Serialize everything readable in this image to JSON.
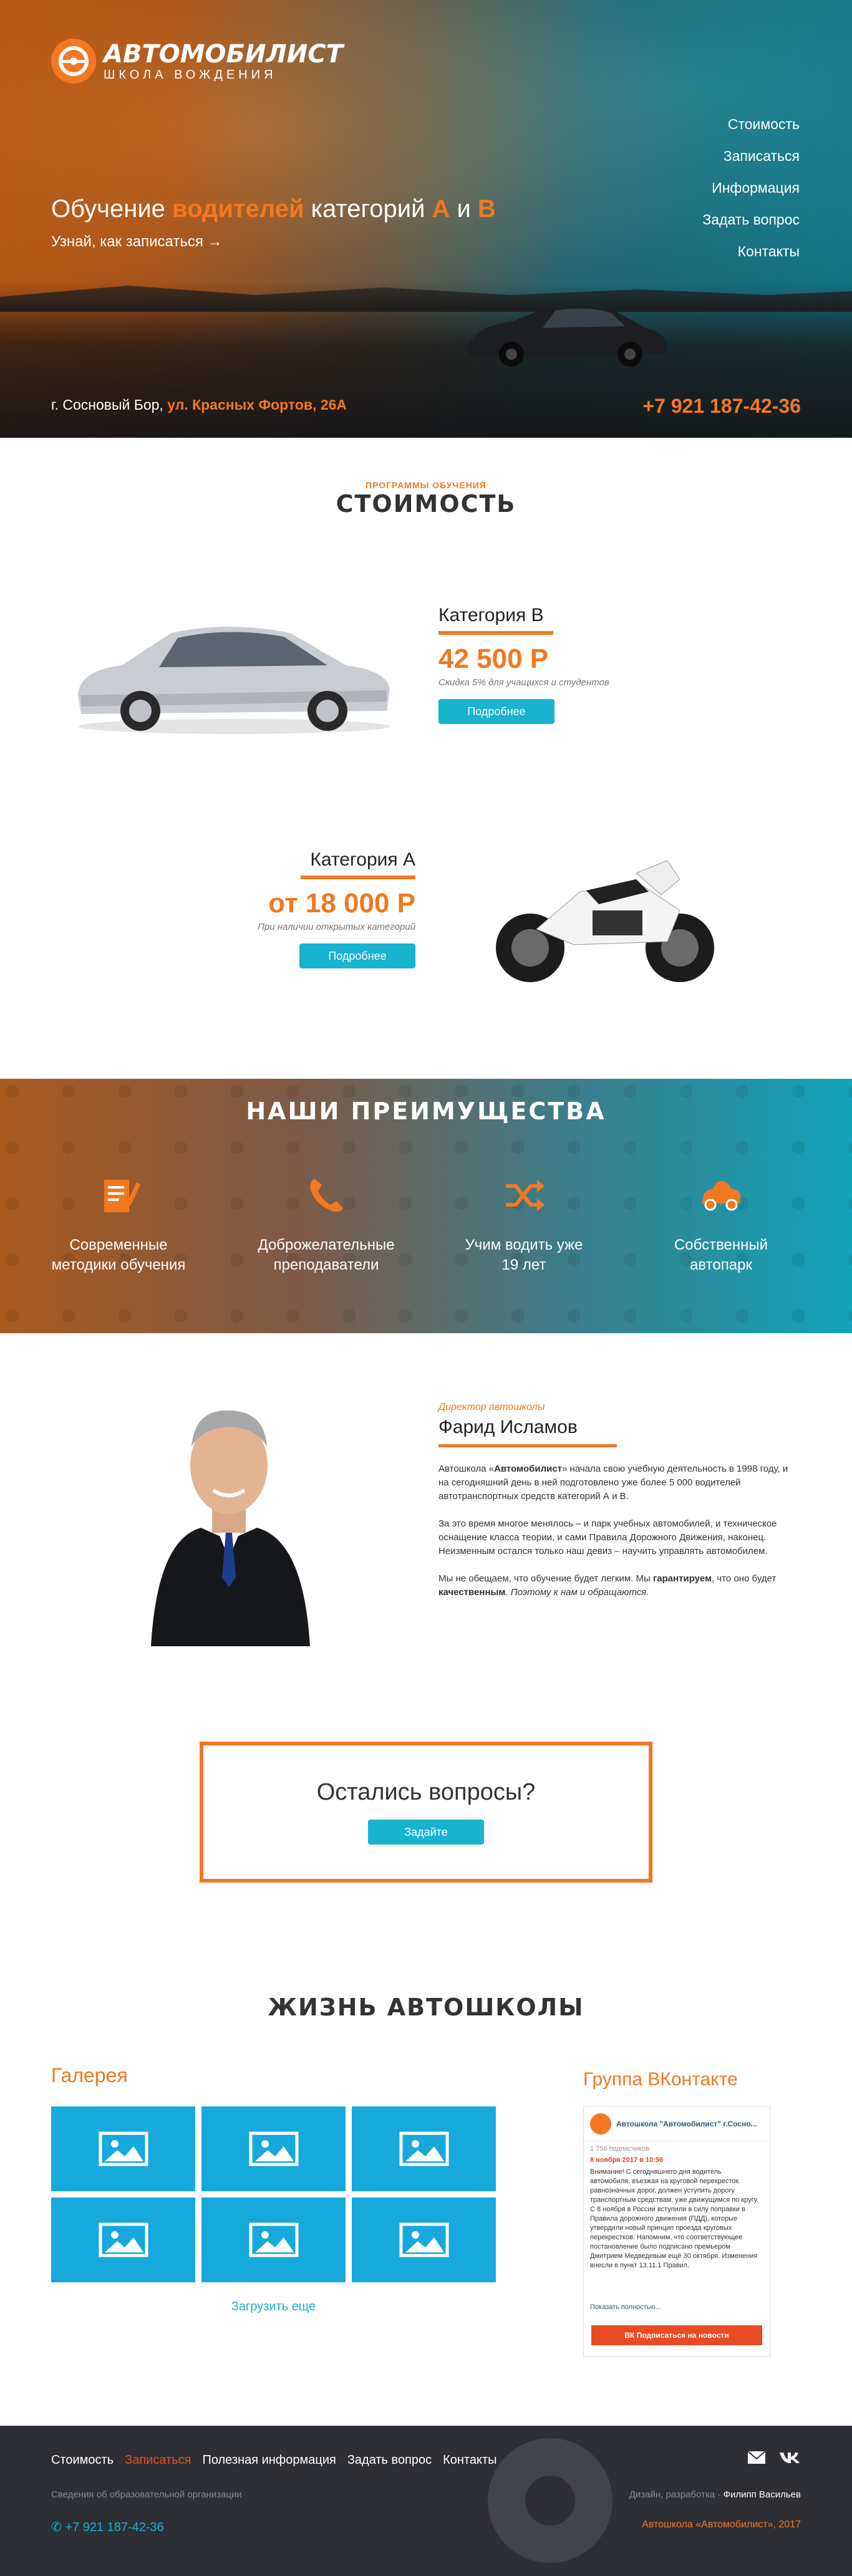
{
  "hero": {
    "logo_name": "АВТОМОБИЛИСТ",
    "logo_sub": "ШКОЛА ВОЖДЕНИЯ",
    "nav": [
      "Стоимость",
      "Записаться",
      "Информация",
      "Задать вопрос",
      "Контакты"
    ],
    "title_prefix": "Обучение ",
    "title_accent": "водителей",
    "title_mid": " категорий ",
    "title_a": "А",
    "title_and": " и ",
    "title_b": "В",
    "subtitle": "Узнай, как записаться →",
    "address_prefix": "г. Сосновый Бор, ",
    "address_street": "ул. Красных Фортов, 26А",
    "phone": "+7 921 187-42-36"
  },
  "price": {
    "kicker": "ПРОГРАММЫ ОБУЧЕНИЯ",
    "title": "СТОИМОСТЬ",
    "card_b": {
      "category": "Категория В",
      "amount": "42 500 Р",
      "note": "Скидка 5% для учащихся и студентов",
      "button": "Подробнее"
    },
    "card_a": {
      "category": "Категория А",
      "amount": "от 18 000 Р",
      "note": "При наличии открытых категорий",
      "button": "Подробнее"
    }
  },
  "advantages": {
    "title": "НАШИ ПРЕИМУЩЕСТВА",
    "items": [
      {
        "line1": "Современные",
        "line2": "методики обучения",
        "icon": "document-pencil-icon"
      },
      {
        "line1": "Доброжелательные",
        "line2": "преподаватели",
        "icon": "phone-icon"
      },
      {
        "line1": "Учим водить уже",
        "line2": "19 лет",
        "icon": "shuffle-icon"
      },
      {
        "line1": "Собственный",
        "line2": "автопарк",
        "icon": "car-icon"
      }
    ]
  },
  "director": {
    "role": "Директор автошколы",
    "name": "Фарид Исламов",
    "p1_a": "Автошкола «",
    "p1_b": "Автомобилист",
    "p1_c": "» начала свою учебную деятельность в 1998 году, и на сегодняшний день в ней подготовлено уже более 5 000 водителей автотранспортных средств категорий А и В.",
    "p2": "За это время многое менялось – и парк учебных автомобилей, и техническое оснащение класса теории, и сами Правила Дорожного Движения, наконец. Неизменным остался только наш девиз – научить управлять автомобилем.",
    "p3_a": "Мы не обещаем, что обучение будет легким. Мы ",
    "p3_b": "гарантируем",
    "p3_c": ", что оно будет ",
    "p3_d": "качественным",
    "p3_e": ". Поэтому к нам и обращаются."
  },
  "ask": {
    "title": "Остались вопросы?",
    "button": "Задайте"
  },
  "life": {
    "title": "ЖИЗНЬ АВТОШКОЛЫ",
    "gallery_title": "Галерея",
    "load_more": "Загрузить еще",
    "vk_title": "Группа ВКонтакте",
    "vk": {
      "name": "Автошкола \"Автомобилист\" г.Сосно...",
      "subscribers": "1 756 подписчиков",
      "date": "8 ноября 2017 в 10:56",
      "post": "Внимание! С сегодняшнего дня водитель автомобиля, въезжая на круговой перекресток равнозначных дорог, должен уступить дорогу транспортным средствам, уже движущимся по кругу. С 8 ноября в России вступили в силу поправки в Правила дорожного движения (ПДД), которые утвердили новый принцип проезда круговых перекрестков. Напомним, что соответствующее постановление было подписано премьером Дмитрием Медведевым ещё 30 октября. Изменения внесли в пункт 13.11.1 Правил.",
      "more": "Показать полностью...",
      "button": "Подписаться на новости"
    }
  },
  "footer": {
    "nav": [
      "Стоимость",
      "Записаться",
      "Полезная информация",
      "Задать вопрос",
      "Контакты"
    ],
    "small": "Сведения об образовательной организации",
    "phone": "+7 921 187-42-36",
    "credit_prefix": "Дизайн, разработка - ",
    "credit_name": "Филипп Васильев",
    "copyright": "Автошкола «Автомобилист», 2017"
  },
  "colors": {
    "accent": "#f27821",
    "button": "#17b3cf",
    "footer": "#2e2f35"
  }
}
